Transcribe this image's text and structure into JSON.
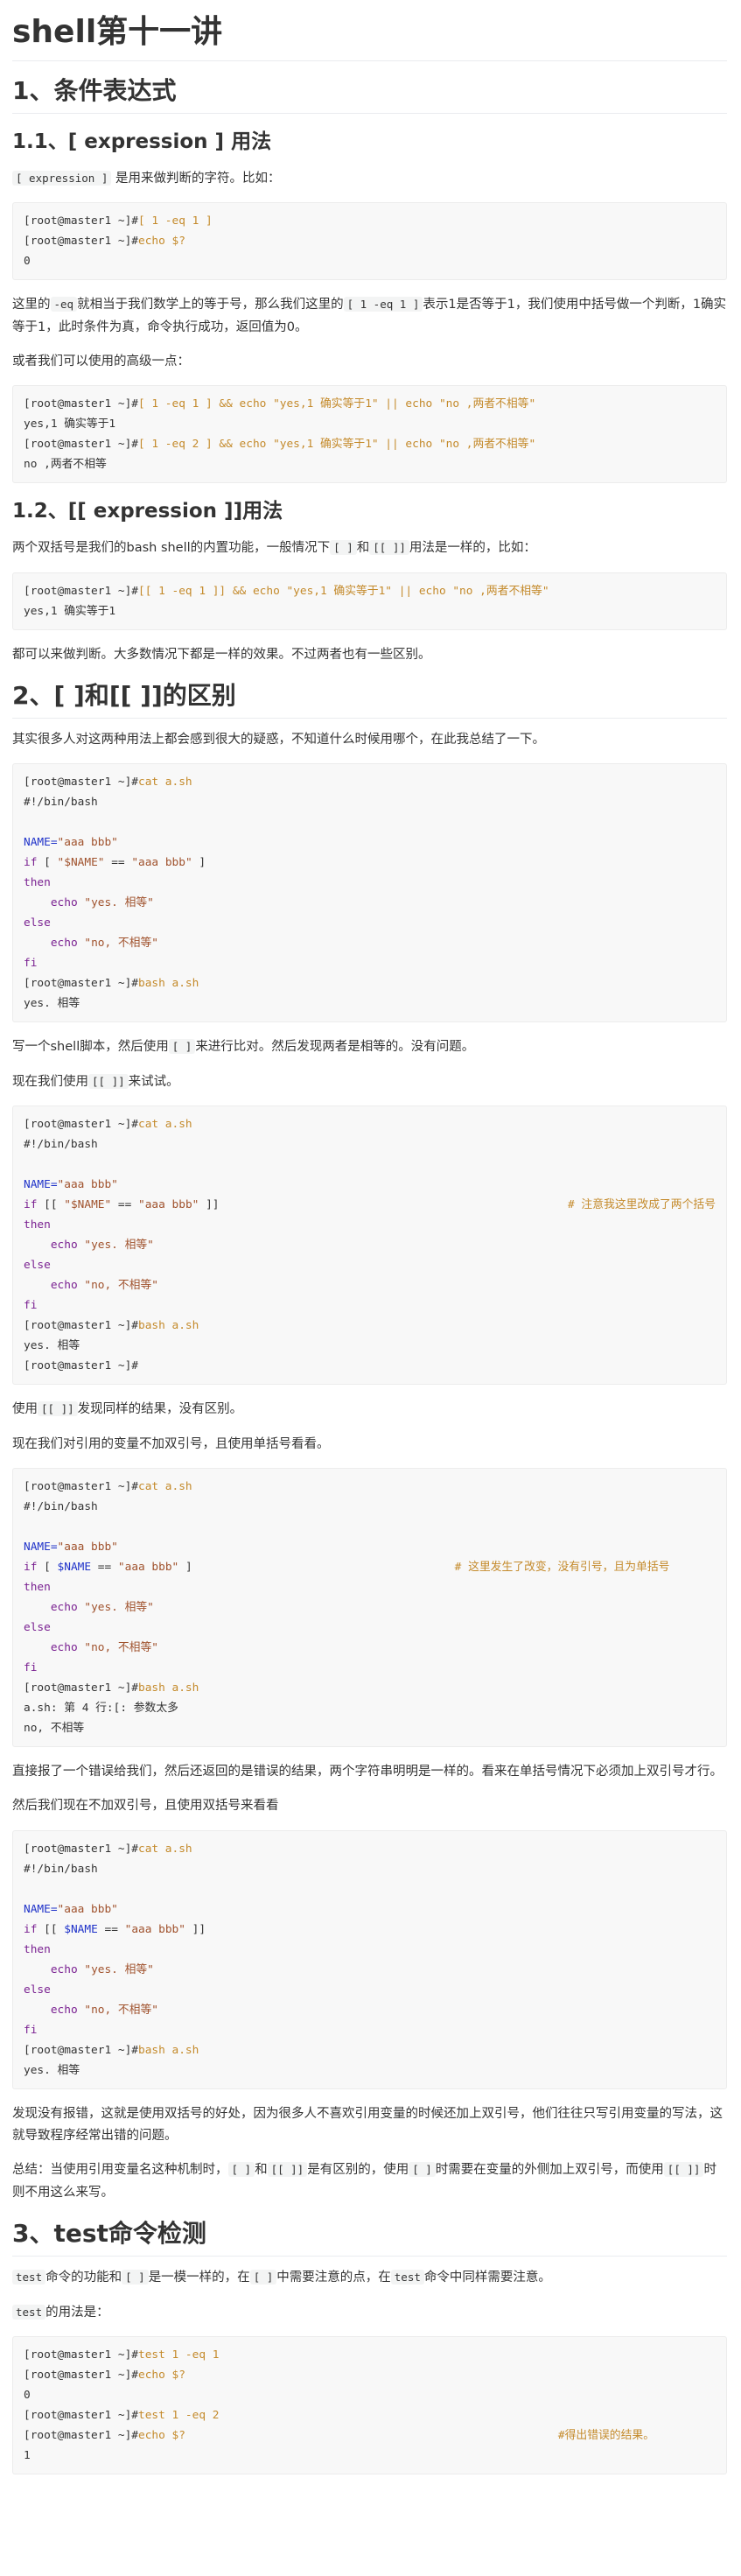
{
  "title": "shell第十一讲",
  "s1": {
    "heading": "1、条件表达式",
    "h11": "1.1、[ expression ] 用法",
    "p1_code": "[ expression ]",
    "p1_text": "是用来做判断的字符。比如：",
    "code1": {
      "l1p": "[root@master1 ~]#",
      "l1c": "[ 1 -eq 1 ]",
      "l2p": "[root@master1 ~]#",
      "l2c": "echo $?",
      "l3": "0"
    },
    "p2_a": "这里的",
    "p2_code1": "-eq",
    "p2_b": "就相当于我们数学上的等于号，那么我们这里的",
    "p2_code2": "[ 1 -eq 1 ]",
    "p2_c": "表示1是否等于1，我们使用中括号做一个判断，1确实等于1，此时条件为真，命令执行成功，返回值为0。",
    "p3": "或者我们可以使用的高级一点：",
    "code2": {
      "l1p": "[root@master1 ~]#",
      "l1c": "[ 1 -eq 1 ] && echo \"yes,1 确实等于1\" || echo \"no ,两者不相等\"",
      "l2": "yes,1 确实等于1",
      "l3p": "[root@master1 ~]#",
      "l3c": "[ 1 -eq 2 ] && echo \"yes,1 确实等于1\" || echo \"no ,两者不相等\"",
      "l4": "no ,两者不相等"
    },
    "h12": "1.2、[[ expression ]]用法",
    "p4_a": "两个双括号是我们的bash shell的内置功能，一般情况下",
    "p4_code1": "[ ]",
    "p4_b": "和",
    "p4_code2": "[[ ]]",
    "p4_c": "用法是一样的，比如：",
    "code3": {
      "l1p": "[root@master1 ~]#",
      "l1c": "[[ 1 -eq 1 ]] && echo \"yes,1 确实等于1\" || echo \"no ,两者不相等\"",
      "l2": "yes,1 确实等于1"
    },
    "p5": "都可以来做判断。大多数情况下都是一样的效果。不过两者也有一些区别。"
  },
  "s2": {
    "heading": "2、[ ]和[[ ]]的区别",
    "p1": "其实很多人对这两种用法上都会感到很大的疑惑，不知道什么时候用哪个，在此我总结了一下。",
    "code1": {
      "l1p": "[root@master1 ~]#",
      "l1c": "cat a.sh",
      "l2": "#!/bin/bash",
      "l4a": "NAME=",
      "l4b": "\"aaa bbb\"",
      "l5a": "if",
      "l5b": " [ ",
      "l5c": "\"$NAME\"",
      "l5d": " == ",
      "l5e": "\"aaa bbb\"",
      "l5f": " ]",
      "l6": "then",
      "l7a": "    echo ",
      "l7b": "\"yes. 相等\"",
      "l8": "else",
      "l9a": "    echo ",
      "l9b": "\"no, 不相等\"",
      "l10": "fi",
      "l11p": "[root@master1 ~]#",
      "l11c": "bash a.sh",
      "l12": "yes. 相等"
    },
    "p2_a": "写一个shell脚本，然后使用",
    "p2_code": "[ ]",
    "p2_b": "来进行比对。然后发现两者是相等的。没有问题。",
    "p3_a": "现在我们使用",
    "p3_code": "[[ ]]",
    "p3_b": "来试试。",
    "code2": {
      "l1p": "[root@master1 ~]#",
      "l1c": "cat a.sh",
      "l2": "#!/bin/bash",
      "l4a": "NAME=",
      "l4b": "\"aaa bbb\"",
      "l5a": "if",
      "l5b": " [[ ",
      "l5c": "\"$NAME\"",
      "l5d": " == ",
      "l5e": "\"aaa bbb\"",
      "l5f": " ]]",
      "l5cm": "# 注意我这里改成了两个括号",
      "l6": "then",
      "l7a": "    echo ",
      "l7b": "\"yes. 相等\"",
      "l8": "else",
      "l9a": "    echo ",
      "l9b": "\"no, 不相等\"",
      "l10": "fi",
      "l11p": "[root@master1 ~]#",
      "l11c": "bash a.sh",
      "l12": "yes. 相等",
      "l13p": "[root@master1 ~]#"
    },
    "p4_a": "使用",
    "p4_code": "[[ ]]",
    "p4_b": "发现同样的结果，没有区别。",
    "p5": "现在我们对引用的变量不加双引号，且使用单括号看看。",
    "code3": {
      "l1p": "[root@master1 ~]#",
      "l1c": "cat a.sh",
      "l2": "#!/bin/bash",
      "l4a": "NAME=",
      "l4b": "\"aaa bbb\"",
      "l5a": "if",
      "l5b": " [ ",
      "l5c": "$NAME",
      "l5d": " == ",
      "l5e": "\"aaa bbb\"",
      "l5f": " ]",
      "l5cm": "# 这里发生了改变，没有引号，且为单括号",
      "l6": "then",
      "l7a": "    echo ",
      "l7b": "\"yes. 相等\"",
      "l8": "else",
      "l9a": "    echo ",
      "l9b": "\"no, 不相等\"",
      "l10": "fi",
      "l11p": "[root@master1 ~]#",
      "l11c": "bash a.sh",
      "l12": "a.sh: 第 4 行:[: 参数太多",
      "l13": "no, 不相等"
    },
    "p6": "直接报了一个错误给我们，然后还返回的是错误的结果，两个字符串明明是一样的。看来在单括号情况下必须加上双引号才行。",
    "p7": "然后我们现在不加双引号，且使用双括号来看看",
    "code4": {
      "l1p": "[root@master1 ~]#",
      "l1c": "cat a.sh",
      "l2": "#!/bin/bash",
      "l4a": "NAME=",
      "l4b": "\"aaa bbb\"",
      "l5a": "if",
      "l5b": " [[ ",
      "l5c": "$NAME",
      "l5d": " == ",
      "l5e": "\"aaa bbb\"",
      "l5f": " ]]",
      "l6": "then",
      "l7a": "    echo ",
      "l7b": "\"yes. 相等\"",
      "l8": "else",
      "l9a": "    echo ",
      "l9b": "\"no, 不相等\"",
      "l10": "fi",
      "l11p": "[root@master1 ~]#",
      "l11c": "bash a.sh",
      "l12": "yes. 相等"
    },
    "p8": "发现没有报错，这就是使用双括号的好处，因为很多人不喜欢引用变量的时候还加上双引号，他们往往只写引用变量的写法，这就导致程序经常出错的问题。",
    "p9_a": "总结：当使用引用变量名这种机制时，",
    "p9_code1": "[ ]",
    "p9_b": "和",
    "p9_code2": "[[ ]]",
    "p9_c": "是有区别的，使用",
    "p9_code3": "[ ]",
    "p9_d": "时需要在变量的外侧加上双引号，而使用",
    "p9_code4": "[[ ]]",
    "p9_e": "时则不用这么来写。"
  },
  "s3": {
    "heading": "3、test命令检测",
    "p1_code1": "test",
    "p1_a": "命令的功能和",
    "p1_code2": "[ ]",
    "p1_b": "是一模一样的，在",
    "p1_code3": "[ ]",
    "p1_c": "中需要注意的点，在",
    "p1_code4": "test",
    "p1_d": "命令中同样需要注意。",
    "p2_code": "test",
    "p2_a": "的用法是：",
    "code1": {
      "l1p": "[root@master1 ~]#",
      "l1c": "test 1 -eq 1",
      "l2p": "[root@master1 ~]#",
      "l2c": "echo $?",
      "l3": "0",
      "l4p": "[root@master1 ~]#",
      "l4c": "test 1 -eq 2",
      "l5p": "[root@master1 ~]#",
      "l5c": "echo $?",
      "l5cm": "#得出错误的结果。",
      "l6": "1"
    }
  }
}
